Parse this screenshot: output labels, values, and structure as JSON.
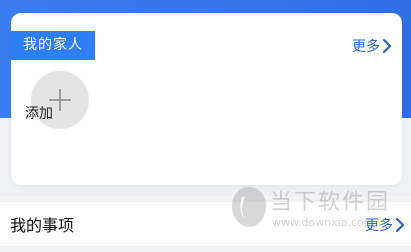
{
  "family": {
    "title": "我的家人",
    "more_label": "更多",
    "add_label": "添加"
  },
  "matters": {
    "title": "我的事项",
    "more_label": "更多"
  },
  "watermark": {
    "text": "当下软件园",
    "url": "www.downxia.com"
  },
  "colors": {
    "header_blue": "#2f6fe6",
    "tag_blue": "#2f7ef5",
    "link_blue": "#2e61c7"
  },
  "icons": {
    "more": "chevron-right-icon",
    "add": "plus-icon"
  }
}
